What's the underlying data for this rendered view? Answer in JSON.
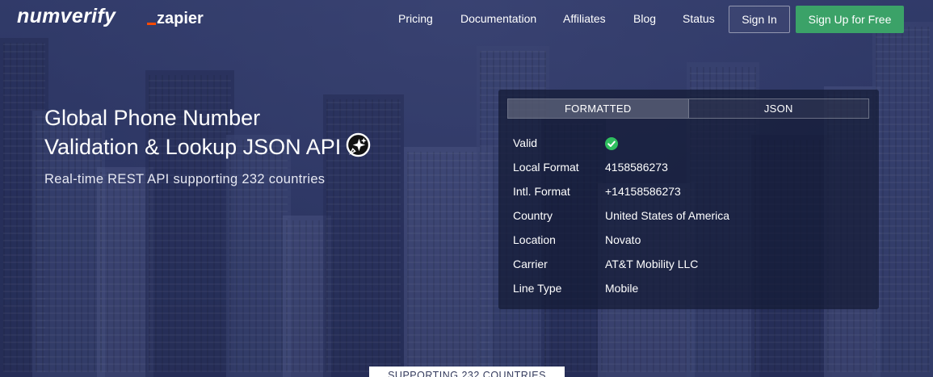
{
  "brand": {
    "logo": "numverify",
    "partner": "zapier",
    "partner_accent": "#ff4a00"
  },
  "nav": {
    "links": [
      "Pricing",
      "Documentation",
      "Affiliates",
      "Blog",
      "Status"
    ],
    "signin_label": "Sign In",
    "signup_label": "Sign Up for Free",
    "signup_color": "#3ba268"
  },
  "hero": {
    "title_line1": "Global Phone Number",
    "title_line2": "Validation & Lookup JSON API",
    "title_icon": "sparkle-chat-icon",
    "subtitle": "Real-time REST API supporting 232 countries"
  },
  "panel": {
    "tabs": [
      {
        "label": "FORMATTED",
        "active": true
      },
      {
        "label": "JSON",
        "active": false
      }
    ],
    "rows": [
      {
        "key": "Valid",
        "value": "",
        "icon": "check-circle-icon"
      },
      {
        "key": "Local Format",
        "value": "4158586273"
      },
      {
        "key": "Intl. Format",
        "value": "+14158586273"
      },
      {
        "key": "Country",
        "value": "United States of America"
      },
      {
        "key": "Location",
        "value": "Novato"
      },
      {
        "key": "Carrier",
        "value": "AT&T Mobility LLC"
      },
      {
        "key": "Line Type",
        "value": "Mobile"
      }
    ],
    "valid_color": "#2fbf5f"
  },
  "footer_badge": "SUPPORTING 232 COUNTRIES"
}
